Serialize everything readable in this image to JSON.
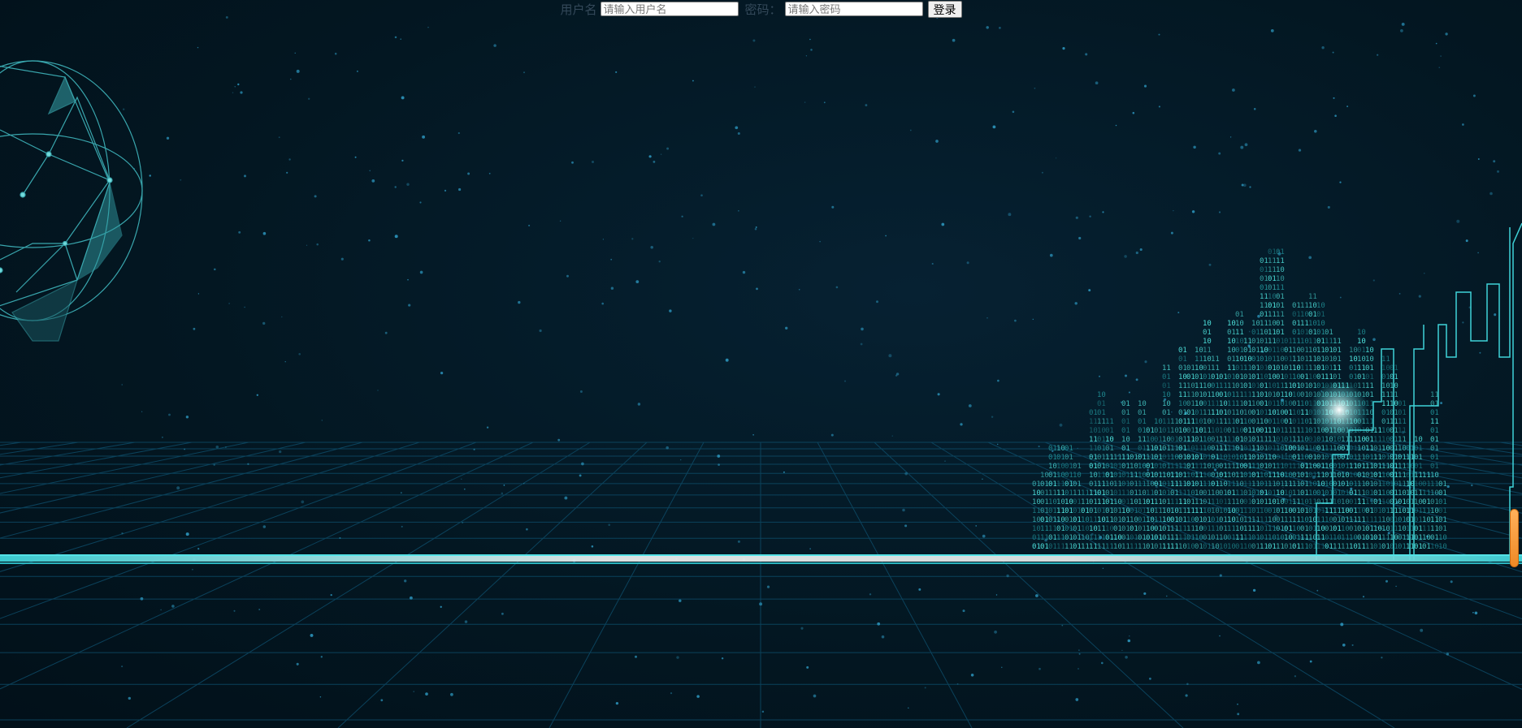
{
  "login": {
    "username_label": "用户名",
    "username_placeholder": "请输入用户名",
    "username_value": "",
    "password_label": "密码：",
    "password_placeholder": "请输入密码",
    "password_value": "",
    "submit_label": "登录"
  },
  "theme": {
    "background": "#031722",
    "accent": "#3fd3d8",
    "grid": "#0d4a66",
    "handle": "#f39a36"
  },
  "icons": {
    "globe": "wireframe-globe-icon",
    "city": "binary-city-icon"
  }
}
